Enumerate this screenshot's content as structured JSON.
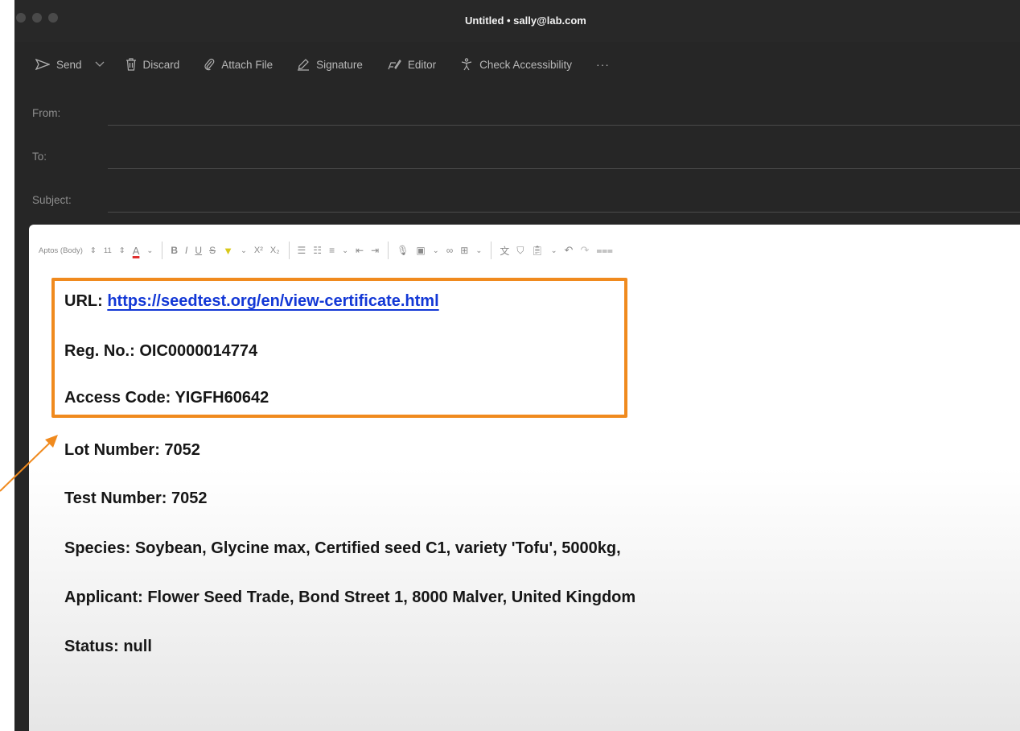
{
  "window": {
    "title": "Untitled • sally@lab.com"
  },
  "toolbar": {
    "send": "Send",
    "discard": "Discard",
    "attach": "Attach File",
    "signature": "Signature",
    "editor": "Editor",
    "accessibility": "Check Accessibility",
    "more": "···"
  },
  "fields": {
    "from": "From:",
    "to": "To:",
    "subject": "Subject:"
  },
  "format": {
    "font": "Aptos (Body)",
    "size": "11"
  },
  "body": {
    "url_label": "URL: ",
    "url": "https://seedtest.org/en/view-certificate.html",
    "reg": "Reg. No.: OIC0000014774",
    "access": "Access Code: YIGFH60642",
    "lot": "Lot Number: 7052",
    "test": "Test Number: 7052",
    "species": "Species: Soybean, Glycine max, Certified seed C1, variety 'Tofu', 5000kg,",
    "applicant": "Applicant: Flower Seed Trade, Bond Street 1, 8000 Malver, United Kingdom",
    "status": "Status: null"
  },
  "colors": {
    "highlight": "#f08a1e",
    "link": "#1338d6",
    "chrome": "#262626"
  }
}
